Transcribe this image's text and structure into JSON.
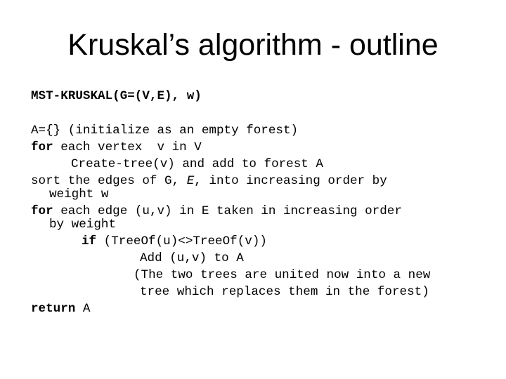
{
  "slide": {
    "title": "Kruskal’s algorithm - outline",
    "signature": "MST-KRUSKAL(G=(V,E), w)",
    "lines": {
      "l1": "A={} (initialize as an empty forest)",
      "l2_kw": "for",
      "l2_rest": " each vertex  v in V",
      "l3": "Create-tree(v) and add to forest A",
      "l4_a": "sort the edges of G, ",
      "l4_it": "E",
      "l4_b": ", into increasing order by",
      "l5": "weight w",
      "l6_kw": "for",
      "l6_rest": " each edge (u,v) in E taken in increasing order",
      "l7": "by weight",
      "l8_kw": "if",
      "l8_rest": " (TreeOf(u)<>TreeOf(v))",
      "l9": "Add (u,v) to A",
      "l10": "(The two trees are united now into a new",
      "l11": "tree which replaces them in the forest)",
      "l12_kw": "return",
      "l12_rest": " A"
    }
  }
}
